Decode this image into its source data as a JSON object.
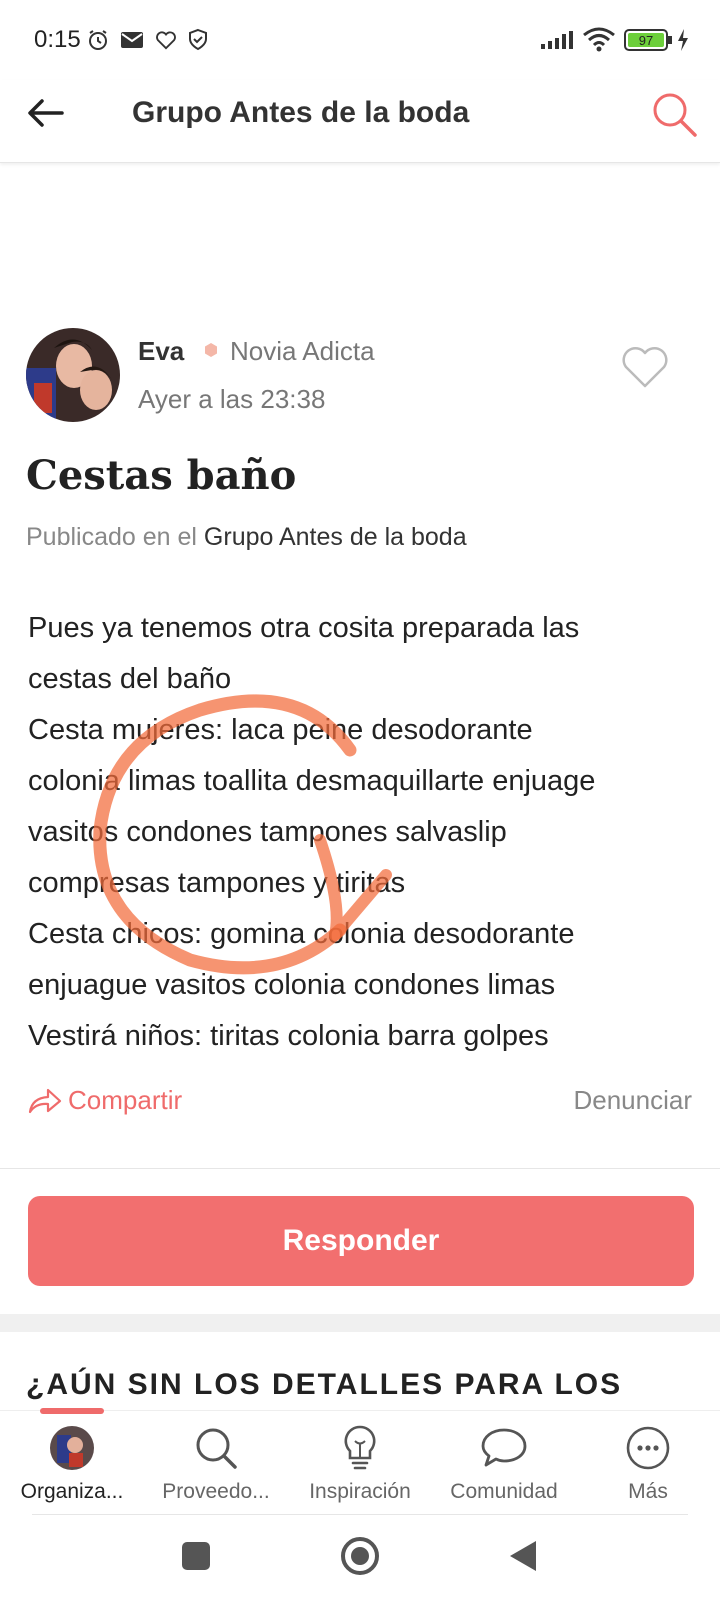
{
  "status_bar": {
    "time": "0:15",
    "battery": "97",
    "icons": [
      "alarm-icon",
      "mail-icon",
      "heart-outline-icon",
      "shield-icon",
      "signal-icon",
      "wifi-icon",
      "battery-icon",
      "charging-icon"
    ]
  },
  "header": {
    "title": "Grupo Antes de la boda",
    "back_icon": "arrow-left-icon",
    "search_icon": "search-icon",
    "accent_color": "#ef6b6b"
  },
  "post": {
    "author": "Eva",
    "rank": "Novia Adicta",
    "time": "Ayer a las 23:38",
    "title": "Cestas baño",
    "published_prefix": "Publicado en el",
    "published_group": "Grupo Antes de la boda",
    "body_lines": [
      "Pues ya tenemos otra cosita preparada las",
      "cestas del baño",
      "Cesta mujeres: laca peine desodorante",
      "colonia limas toallita desmaquillarte enjuage",
      "vasitos condones tampones salvaslip",
      "compresas tampones y tiritas",
      "Cesta chicos: gomina colonia desodorante",
      "enjuague vasitos colonia condones limas",
      "Vestirá niños: tiritas colonia barra golpes"
    ],
    "share_label": "Compartir",
    "report_label": "Denunciar"
  },
  "reply_button": "Responder",
  "promo_heading": "¿AÚN SIN LOS DETALLES PARA LOS",
  "bottom_nav": [
    {
      "label": "Organiza...",
      "icon": "avatar-icon",
      "active": true
    },
    {
      "label": "Proveedo...",
      "icon": "search-icon",
      "active": false
    },
    {
      "label": "Inspiración",
      "icon": "lightbulb-icon",
      "active": false
    },
    {
      "label": "Comunidad",
      "icon": "chat-bubble-icon",
      "active": false
    },
    {
      "label": "Más",
      "icon": "more-icon",
      "active": false
    }
  ],
  "system_nav": [
    "recents-icon",
    "home-icon",
    "back-icon"
  ]
}
